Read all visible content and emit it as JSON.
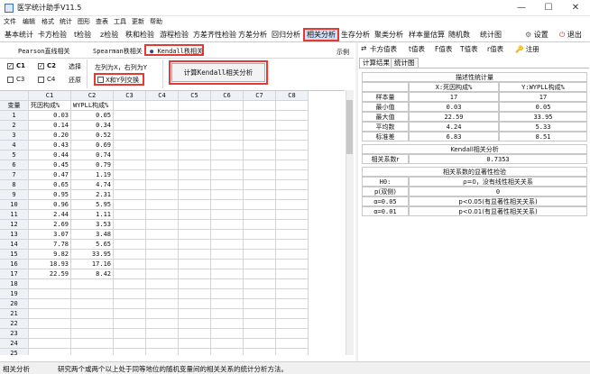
{
  "window": {
    "title": "医学统计助手V11.5",
    "minimize": "—",
    "maximize": "☐",
    "close": "✕"
  },
  "menu": [
    "文件",
    "编辑",
    "格式",
    "统计",
    "图形",
    "查表",
    "工具",
    "更新",
    "帮助"
  ],
  "tabs": [
    {
      "label": "基本统计",
      "active": false
    },
    {
      "label": "卡方检验",
      "active": false
    },
    {
      "label": "t检验",
      "active": false
    },
    {
      "label": "z检验",
      "active": false
    },
    {
      "label": "秩和检验",
      "active": false
    },
    {
      "label": "游程检验",
      "active": false
    },
    {
      "label": "方差齐性检验",
      "active": false
    },
    {
      "label": "方差分析",
      "active": false
    },
    {
      "label": "回归分析",
      "active": false
    },
    {
      "label": "相关分析",
      "active": true
    },
    {
      "label": "生存分析",
      "active": false
    },
    {
      "label": "聚类分析",
      "active": false
    },
    {
      "label": "样本量估算",
      "active": false
    },
    {
      "label": "随机数",
      "active": false
    },
    {
      "label": "统计图",
      "active": false
    }
  ],
  "tab_right": {
    "settings": "设置",
    "exit": "退出"
  },
  "methods": {
    "pearson": "Pearson直线相关",
    "spearman": "Spearman秩相关",
    "kendall": "Kendall秩相关",
    "example": "示例"
  },
  "columns_select": {
    "c1": "C1",
    "c2": "C2",
    "c3": "C3",
    "c4": "C4",
    "c1_checked": true,
    "c2_checked": true,
    "c3_checked": false,
    "c4_checked": false,
    "select_label": "选择",
    "clear_label": "清除",
    "restore_label": "还原"
  },
  "options": {
    "hint": "左列为X，右列为Y",
    "swap_label": "X和Y列交换",
    "swap_checked": false
  },
  "compute_button": "计算Kendall相关分析",
  "grid": {
    "col_headers": [
      "C1",
      "C2",
      "C3",
      "C4",
      "C5",
      "C6",
      "C7",
      "C8"
    ],
    "row_header_label": "变量",
    "var_names": [
      "死因构成%",
      "WYPLL构成%"
    ],
    "rows": [
      [
        "0.03",
        "0.05"
      ],
      [
        "0.14",
        "0.34"
      ],
      [
        "0.20",
        "0.52"
      ],
      [
        "0.43",
        "0.69"
      ],
      [
        "0.44",
        "0.74"
      ],
      [
        "0.45",
        "0.79"
      ],
      [
        "0.47",
        "1.19"
      ],
      [
        "0.65",
        "4.74"
      ],
      [
        "0.95",
        "2.31"
      ],
      [
        "0.96",
        "5.95"
      ],
      [
        "2.44",
        "1.11"
      ],
      [
        "2.69",
        "3.53"
      ],
      [
        "3.07",
        "3.48"
      ],
      [
        "7.78",
        "5.65"
      ],
      [
        "9.82",
        "33.95"
      ],
      [
        "18.93",
        "17.16"
      ],
      [
        "22.59",
        "8.42"
      ],
      [
        "",
        ""
      ],
      [
        "",
        ""
      ],
      [
        "",
        ""
      ],
      [
        "",
        ""
      ],
      [
        "",
        ""
      ],
      [
        "",
        ""
      ],
      [
        "",
        ""
      ],
      [
        "",
        ""
      ]
    ]
  },
  "right_toolbar": [
    "卡方值表",
    "t值表",
    "F值表",
    "T值表",
    "r值表",
    "注册"
  ],
  "right_tabs": [
    {
      "label": "计算结果",
      "active": true
    },
    {
      "label": "统计图",
      "active": false
    }
  ],
  "results": {
    "desc_title": "描述性统计量",
    "col_x": "X:死因构成%",
    "col_y": "Y:WYPLL构成%",
    "stats": [
      {
        "name": "样本量",
        "x": "17",
        "y": "17"
      },
      {
        "name": "最小值",
        "x": "0.03",
        "y": "0.05"
      },
      {
        "name": "最大值",
        "x": "22.59",
        "y": "33.95"
      },
      {
        "name": "平均数",
        "x": "4.24",
        "y": "5.33"
      },
      {
        "name": "标准差",
        "x": "6.83",
        "y": "8.51"
      }
    ],
    "kendall_title": "Kendall相关分析",
    "coef_label": "相关系数r",
    "coef_value": "0.7353",
    "sig_title": "相关系数的显著性检验",
    "h0_label": "H0:",
    "h0_value": "ρ=0，没有线性相关关系",
    "p_label": "p(双侧)",
    "p_value": "0",
    "a05_label": "α=0.05",
    "a05_value": "p<0.05(有显著性相关关系)",
    "a01_label": "α=0.01",
    "a01_value": "p<0.01(有显著性相关关系)"
  },
  "status": {
    "module": "相关分析",
    "description": "研究两个或两个以上处于同等地位的随机变量间的相关关系的统计分析方法。"
  }
}
